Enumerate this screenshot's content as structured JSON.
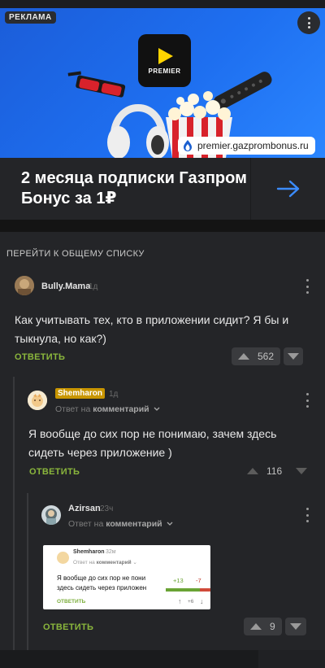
{
  "ad": {
    "badge": "РЕКЛАМА",
    "logo_text": "PREMIER",
    "site": "premier.gazprombonus.ru",
    "title": "2 месяца подписки Газпром Бонус за 1₽",
    "colors": {
      "banner": "#1e6ff0",
      "logo_accent": "#ffd400",
      "arrow": "#3b8cff"
    }
  },
  "comments_section": {
    "back_link": "ПЕРЕЙТИ К ОБЩЕМУ СПИСКУ",
    "reply_label": "ОТВЕТИТЬ",
    "reply_to_prefix": "Ответ на",
    "reply_to_target": "комментарий",
    "comments": [
      {
        "author": "Bully.Mama",
        "time": "1д",
        "text": "Как учитывать тех, кто в приложении сидит? Я бы и тыкнула, но как?)",
        "rating": "562"
      },
      {
        "author": "Shemharon",
        "time": "1д",
        "text": "Я вообще до сих пор не понимаю, зачем здесь сидеть через приложение )",
        "rating": "116"
      },
      {
        "author": "Azirsan",
        "time": "23ч",
        "rating": "9",
        "attachment": {
          "author": "Shemharon",
          "time": "32м",
          "reply_prefix": "Ответ на",
          "reply_target": "комментарий",
          "text_line1": "Я вообще до сих пор не пони",
          "text_line2": "здесь сидеть через приложен",
          "plus": "+13",
          "minus": "-7",
          "button": "ОТВЕТИТЬ",
          "count": "+6"
        }
      }
    ]
  },
  "colors": {
    "accent_green": "#8ab63c",
    "background": "#242528",
    "badge_gold": "#c89500"
  }
}
